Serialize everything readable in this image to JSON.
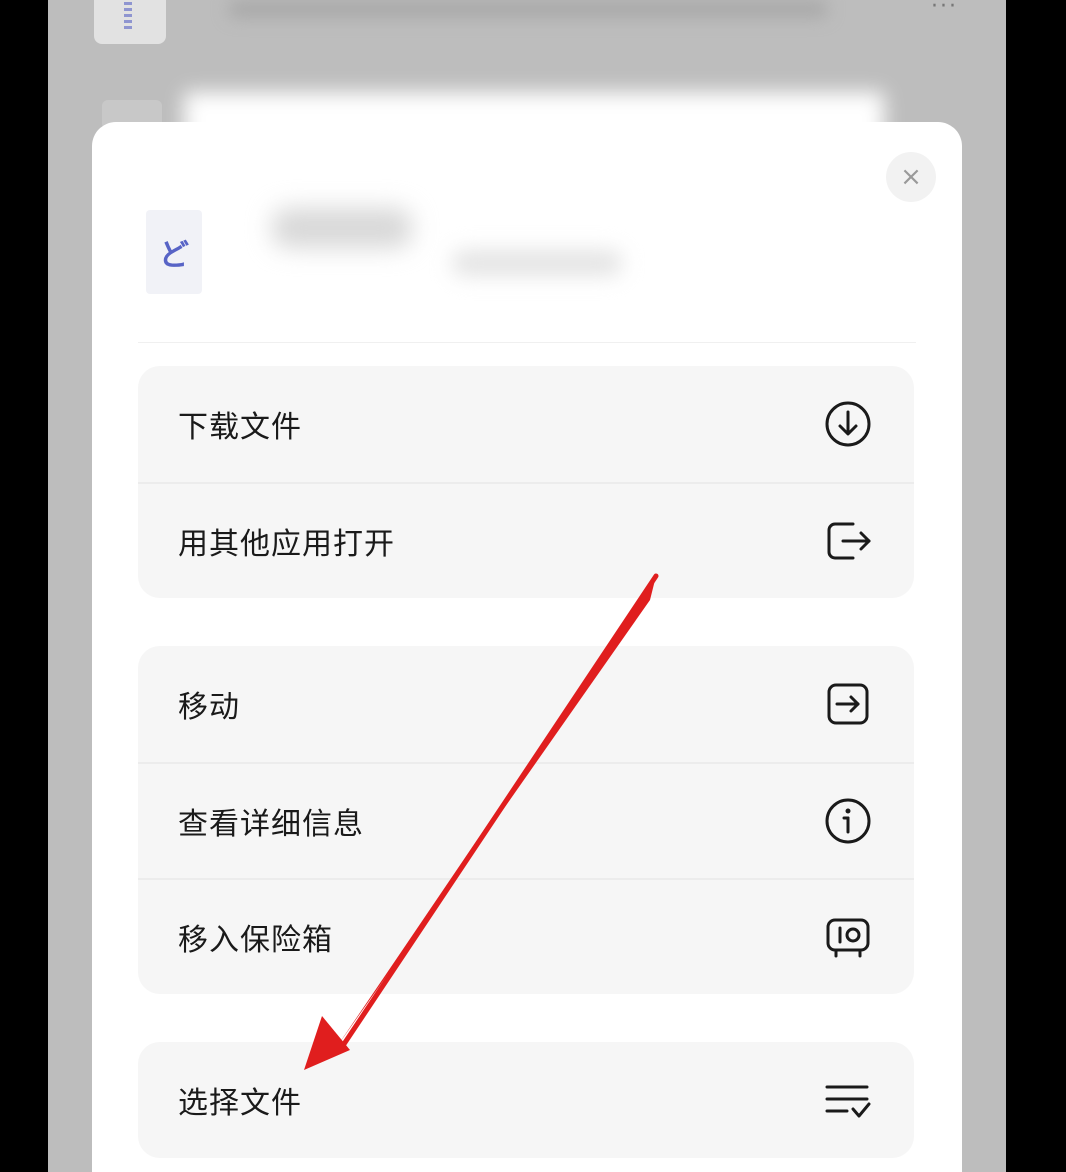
{
  "background": {
    "more_icon": "···"
  },
  "sheet": {
    "close_icon": "×",
    "file_icon_glyph": "ど"
  },
  "groups": [
    {
      "items": [
        {
          "label": "下载文件",
          "icon": "download-icon"
        },
        {
          "label": "用其他应用打开",
          "icon": "open-external-icon"
        }
      ]
    },
    {
      "items": [
        {
          "label": "移动",
          "icon": "move-icon"
        },
        {
          "label": "查看详细信息",
          "icon": "info-icon"
        },
        {
          "label": "移入保险箱",
          "icon": "safe-icon"
        }
      ]
    },
    {
      "items": [
        {
          "label": "选择文件",
          "icon": "select-list-icon"
        }
      ]
    }
  ],
  "colors": {
    "annotation_arrow": "#e01e1e",
    "sheet_bg": "#ffffff",
    "group_bg": "#f6f6f6",
    "dim_overlay": "#bdbdbd"
  }
}
